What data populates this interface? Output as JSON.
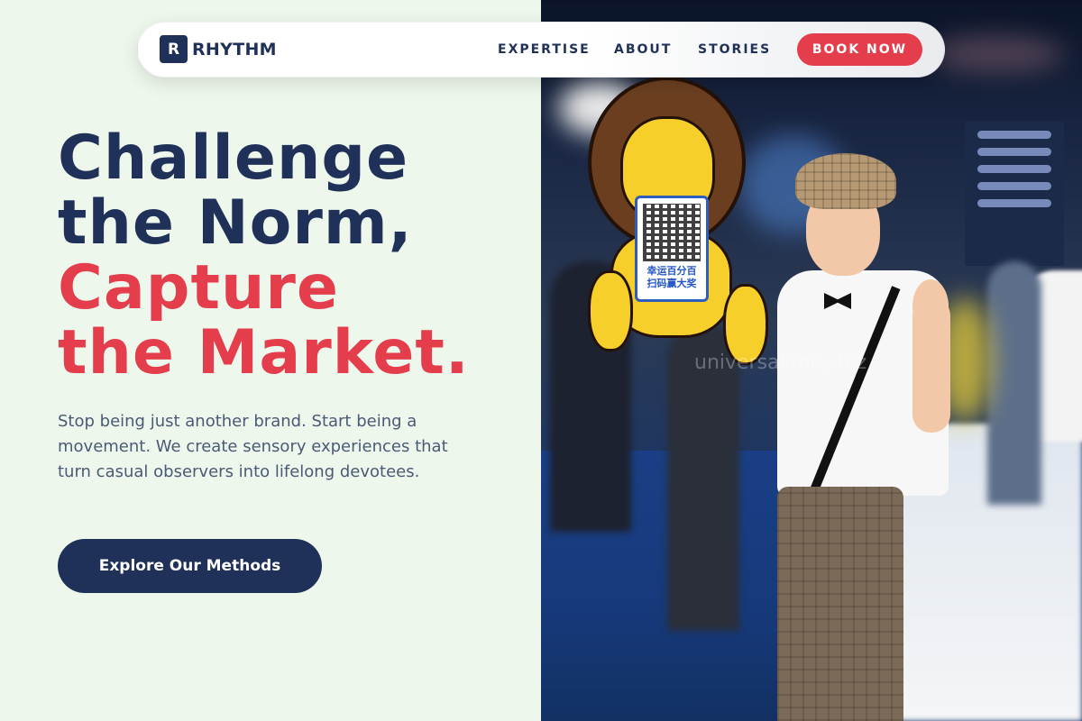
{
  "brand": {
    "mark": "R",
    "name": "RHYTHM"
  },
  "nav": {
    "links": [
      "EXPERTISE",
      "ABOUT",
      "STORIES"
    ],
    "cta": "BOOK NOW"
  },
  "hero": {
    "headline_lines": [
      "Challenge",
      "the Norm,",
      "Capture",
      "the Market."
    ],
    "body": "Stop being just another brand. Start being a movement. We create sensory experiences that turn casual observers into lifelong devotees.",
    "cta": "Explore Our Methods"
  },
  "photo": {
    "sign_text_line1": "幸运百分百",
    "sign_text_line2": "扫码赢大奖",
    "watermark": "universalirony.biz"
  },
  "colors": {
    "navy": "#1f3158",
    "accent_red": "#e43d4c",
    "page_bg": "#eef7ec",
    "body_text": "#4a5a75"
  }
}
